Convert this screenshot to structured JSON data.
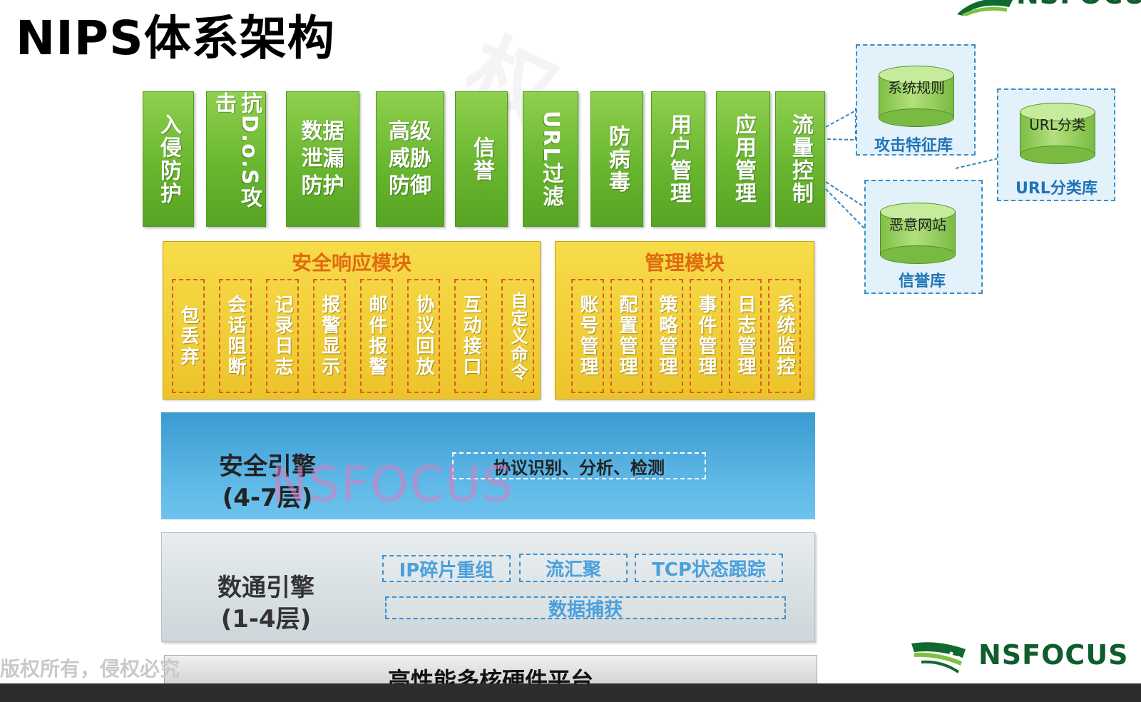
{
  "title": "NIPS体系架构",
  "logo": {
    "brand": "NSFOCUS"
  },
  "apps": [
    "入侵防护",
    "抗D.o.S攻击",
    "数据泄漏防护",
    "高级威胁防御",
    "信誉",
    "URL过滤",
    "防病毒",
    "用户管理",
    "应用管理",
    "流量控制"
  ],
  "databases": {
    "attack": {
      "cylinder": "系统规则",
      "name": "攻击特征库"
    },
    "url": {
      "cylinder": "URL分类",
      "name": "URL分类库"
    },
    "reputation": {
      "cylinder": "恶意网站",
      "name": "信誉库"
    }
  },
  "security_response": {
    "title": "安全响应模块",
    "items": [
      "包丢弃",
      "会话阻断",
      "记录日志",
      "报警显示",
      "邮件报警",
      "协议回放",
      "互动接口",
      "自定义命令"
    ]
  },
  "management": {
    "title": "管理模块",
    "items": [
      "账号管理",
      "配置管理",
      "策略管理",
      "事件管理",
      "日志管理",
      "系统监控"
    ]
  },
  "security_engine": {
    "name": "安全引擎",
    "layers": "(4-7层)",
    "function": "协议识别、分析、检测"
  },
  "data_engine": {
    "name": "数通引擎",
    "layers": "(1-4层)",
    "functions": [
      "IP碎片重组",
      "流汇聚",
      "TCP状态跟踪"
    ],
    "capture": "数据捕获"
  },
  "hardware": "高性能多核硬件平台",
  "watermark": "NSFOCUS",
  "copyright": "版权所有，侵权必究"
}
